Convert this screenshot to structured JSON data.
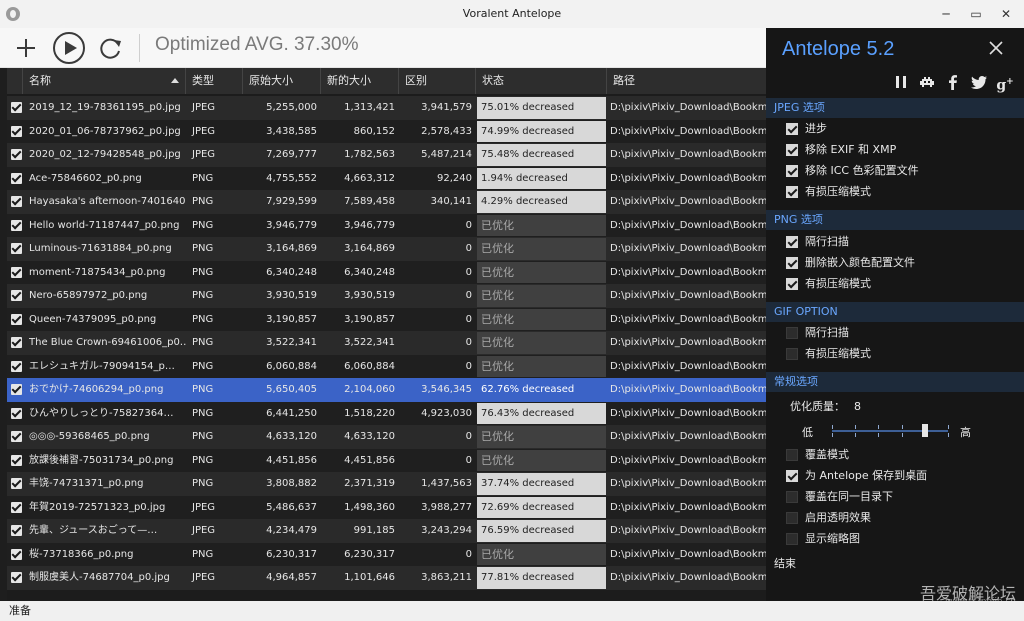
{
  "window": {
    "title": "Voralent Antelope",
    "minimize": "─",
    "maximize": "▭",
    "close": "✕"
  },
  "toolbar": {
    "status": "Optimized AVG. 37.30%"
  },
  "table": {
    "headers": [
      "名称",
      "类型",
      "原始大小",
      "新的大小",
      "区别",
      "状态",
      "路径"
    ],
    "rows": [
      {
        "name": "2019_12_19-78361195_p0.jpg",
        "type": "JPEG",
        "orig": "5,255,000",
        "new": "1,313,421",
        "diff": "3,941,579",
        "status": "75.01% decreased",
        "kind": "dec",
        "path": "D:\\pixiv\\Pixiv_Download\\Bookmark\\"
      },
      {
        "name": "2020_01_06-78737962_p0.jpg",
        "type": "JPEG",
        "orig": "3,438,585",
        "new": "860,152",
        "diff": "2,578,433",
        "status": "74.99% decreased",
        "kind": "dec",
        "path": "D:\\pixiv\\Pixiv_Download\\Bookmark\\"
      },
      {
        "name": "2020_02_12-79428548_p0.jpg",
        "type": "JPEG",
        "orig": "7,269,777",
        "new": "1,782,563",
        "diff": "5,487,214",
        "status": "75.48% decreased",
        "kind": "dec",
        "path": "D:\\pixiv\\Pixiv_Download\\Bookmark\\"
      },
      {
        "name": "Ace-75846602_p0.png",
        "type": "PNG",
        "orig": "4,755,552",
        "new": "4,663,312",
        "diff": "92,240",
        "status": "1.94% decreased",
        "kind": "dec",
        "path": "D:\\pixiv\\Pixiv_Download\\Bookmark\\"
      },
      {
        "name": "Hayasaka's afternoon-7401640…",
        "type": "PNG",
        "orig": "7,929,599",
        "new": "7,589,458",
        "diff": "340,141",
        "status": "4.29% decreased",
        "kind": "dec",
        "path": "D:\\pixiv\\Pixiv_Download\\Bookmark\\"
      },
      {
        "name": "Hello world-71187447_p0.png",
        "type": "PNG",
        "orig": "3,946,779",
        "new": "3,946,779",
        "diff": "0",
        "status": "已优化",
        "kind": "opt",
        "path": "D:\\pixiv\\Pixiv_Download\\Bookmark\\"
      },
      {
        "name": "Luminous-71631884_p0.png",
        "type": "PNG",
        "orig": "3,164,869",
        "new": "3,164,869",
        "diff": "0",
        "status": "已优化",
        "kind": "opt",
        "path": "D:\\pixiv\\Pixiv_Download\\Bookmark\\"
      },
      {
        "name": "moment-71875434_p0.png",
        "type": "PNG",
        "orig": "6,340,248",
        "new": "6,340,248",
        "diff": "0",
        "status": "已优化",
        "kind": "opt",
        "path": "D:\\pixiv\\Pixiv_Download\\Bookmark\\"
      },
      {
        "name": "Nero-65897972_p0.png",
        "type": "PNG",
        "orig": "3,930,519",
        "new": "3,930,519",
        "diff": "0",
        "status": "已优化",
        "kind": "opt",
        "path": "D:\\pixiv\\Pixiv_Download\\Bookmark\\"
      },
      {
        "name": "Queen-74379095_p0.png",
        "type": "PNG",
        "orig": "3,190,857",
        "new": "3,190,857",
        "diff": "0",
        "status": "已优化",
        "kind": "opt",
        "path": "D:\\pixiv\\Pixiv_Download\\Bookmark\\"
      },
      {
        "name": "The Blue Crown-69461006_p0…",
        "type": "PNG",
        "orig": "3,522,341",
        "new": "3,522,341",
        "diff": "0",
        "status": "已优化",
        "kind": "opt",
        "path": "D:\\pixiv\\Pixiv_Download\\Bookmark\\"
      },
      {
        "name": "エレシュキガル-79094154_p…",
        "type": "PNG",
        "orig": "6,060,884",
        "new": "6,060,884",
        "diff": "0",
        "status": "已优化",
        "kind": "opt",
        "path": "D:\\pixiv\\Pixiv_Download\\Bookmark\\"
      },
      {
        "name": "おでかけ-74606294_p0.png",
        "type": "PNG",
        "orig": "5,650,405",
        "new": "2,104,060",
        "diff": "3,546,345",
        "status": "62.76% decreased",
        "kind": "dec",
        "selected": true,
        "path": "D:\\pixiv\\Pixiv_Download\\Bookmark\\"
      },
      {
        "name": "ひんやりしっとり-75827364…",
        "type": "PNG",
        "orig": "6,441,250",
        "new": "1,518,220",
        "diff": "4,923,030",
        "status": "76.43% decreased",
        "kind": "dec",
        "path": "D:\\pixiv\\Pixiv_Download\\Bookmark\\"
      },
      {
        "name": "◎◎◎-59368465_p0.png",
        "type": "PNG",
        "orig": "4,633,120",
        "new": "4,633,120",
        "diff": "0",
        "status": "已优化",
        "kind": "opt",
        "path": "D:\\pixiv\\Pixiv_Download\\Bookmark\\"
      },
      {
        "name": "放課後補習-75031734_p0.png",
        "type": "PNG",
        "orig": "4,451,856",
        "new": "4,451,856",
        "diff": "0",
        "status": "已优化",
        "kind": "opt",
        "path": "D:\\pixiv\\Pixiv_Download\\Bookmark\\"
      },
      {
        "name": "丰饶-74731371_p0.png",
        "type": "PNG",
        "orig": "3,808,882",
        "new": "2,371,319",
        "diff": "1,437,563",
        "status": "37.74% decreased",
        "kind": "dec",
        "path": "D:\\pixiv\\Pixiv_Download\\Bookmark\\"
      },
      {
        "name": "年賀2019-72571323_p0.jpg",
        "type": "JPEG",
        "orig": "5,486,637",
        "new": "1,498,360",
        "diff": "3,988,277",
        "status": "72.69% decreased",
        "kind": "dec",
        "path": "D:\\pixiv\\Pixiv_Download\\Bookmark\\"
      },
      {
        "name": "先輩、ジュースおごって—…",
        "type": "JPEG",
        "orig": "4,234,479",
        "new": "991,185",
        "diff": "3,243,294",
        "status": "76.59% decreased",
        "kind": "dec",
        "path": "D:\\pixiv\\Pixiv_Download\\Bookmark\\"
      },
      {
        "name": "桜-73718366_p0.png",
        "type": "PNG",
        "orig": "6,230,317",
        "new": "6,230,317",
        "diff": "0",
        "status": "已优化",
        "kind": "opt",
        "path": "D:\\pixiv\\Pixiv_Download\\Bookmark\\"
      },
      {
        "name": "制服虞美人-74687704_p0.jpg",
        "type": "JPEG",
        "orig": "4,964,857",
        "new": "1,101,646",
        "diff": "3,863,211",
        "status": "77.81% decreased",
        "kind": "dec",
        "path": "D:\\pixiv\\Pixiv_Download\\Bookmark\\"
      }
    ]
  },
  "statusbar": {
    "text": "准备"
  },
  "panel": {
    "title": "Antelope  5.2",
    "icons": [
      "pause-icon",
      "invader-icon",
      "facebook-icon",
      "twitter-icon",
      "google-plus-icon"
    ],
    "jpeg_header": "JPEG 选项",
    "jpeg_options": [
      {
        "label": "进步",
        "checked": true
      },
      {
        "label": "移除 EXIF 和 XMP",
        "checked": true
      },
      {
        "label": "移除 ICC 色彩配置文件",
        "checked": true
      },
      {
        "label": "有损压缩模式",
        "checked": true
      }
    ],
    "png_header": "PNG 选项",
    "png_options": [
      {
        "label": "隔行扫描",
        "checked": true
      },
      {
        "label": "删除嵌入颜色配置文件",
        "checked": true
      },
      {
        "label": "有损压缩模式",
        "checked": true
      }
    ],
    "gif_header": "GIF OPTION",
    "gif_options": [
      {
        "label": "隔行扫描",
        "checked": false
      },
      {
        "label": "有损压缩模式",
        "checked": false
      }
    ],
    "general_header": "常规选项",
    "quality_label": "优化质量：",
    "quality_value": "8",
    "quality_fraction": 0.8,
    "slider_low": "低",
    "slider_high": "高",
    "general_options": [
      {
        "label": "覆盖模式",
        "checked": false
      },
      {
        "label": "为 Antelope 保存到桌面",
        "checked": true
      },
      {
        "label": "覆盖在同一目录下",
        "checked": false
      },
      {
        "label": "启用透明效果",
        "checked": false
      },
      {
        "label": "显示缩略图",
        "checked": false
      }
    ],
    "end_label": "结束"
  },
  "watermark": {
    "text": "吾爱破解论坛",
    "url": "www.52pojie.cn"
  }
}
